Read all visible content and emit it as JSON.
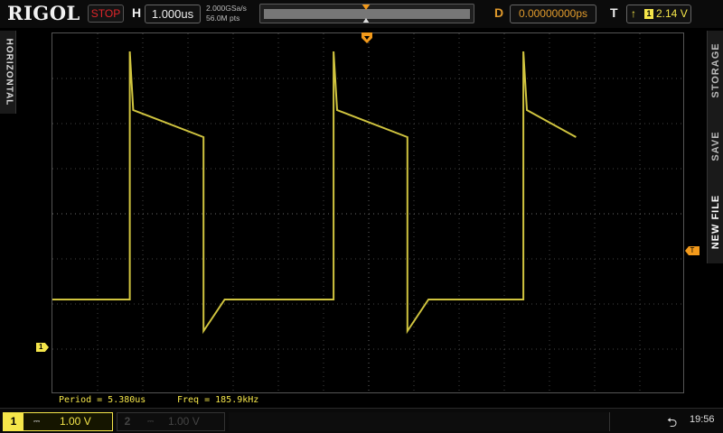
{
  "brand": "RIGOL",
  "run_state": "STOP",
  "horizontal": {
    "label": "H",
    "scale": "1.000us"
  },
  "acquisition": {
    "sample_rate": "2.000GSa/s",
    "memory_depth": "56.0M pts"
  },
  "delay": {
    "label": "D",
    "value": "0.00000000ps"
  },
  "trigger": {
    "label": "T",
    "edge_symbol": "↑",
    "source": "1",
    "level": "2.14 V"
  },
  "left_tab": {
    "label": "HORIZONTAL"
  },
  "right_tab": {
    "items": [
      "STORAGE",
      "SAVE",
      "NEW FILE"
    ]
  },
  "markers": {
    "channel_ground": "1",
    "trigger_level": "T"
  },
  "measurements": {
    "period": "Period = 5.380us",
    "freq": "Freq = 185.9kHz"
  },
  "channels": [
    {
      "number": "1",
      "coupling": "⎓",
      "scale": "1.00 V",
      "active": true,
      "color": "#f5e64a"
    },
    {
      "number": "2",
      "coupling": "⎓",
      "scale": "1.00 V",
      "active": false,
      "color": "#444444"
    }
  ],
  "status": {
    "usb_icon": "usb-icon",
    "time": "19:56"
  },
  "colors": {
    "ch1": "#f5e64a",
    "run_stop": "#e0262a",
    "trigger_marker": "#f39a1b"
  },
  "chart_data": {
    "type": "line",
    "x": [
      -4.0,
      -2.9,
      -2.9,
      -2.85,
      -1.85,
      -1.85,
      -1.55,
      0.0,
      0.0,
      0.05,
      1.05,
      1.05,
      1.35,
      2.7,
      2.7,
      2.75,
      3.45
    ],
    "series": [
      {
        "values": [
          0.0,
          0.0,
          2.75,
          2.1,
          1.8,
          -0.35,
          0.0,
          0.0,
          2.75,
          2.1,
          1.8,
          -0.35,
          0.0,
          0.0,
          2.75,
          2.1,
          1.8
        ]
      }
    ],
    "xlim": [
      -4.0,
      5.0
    ],
    "ylim": [
      -1.05,
      2.95
    ],
    "grid": true
  }
}
